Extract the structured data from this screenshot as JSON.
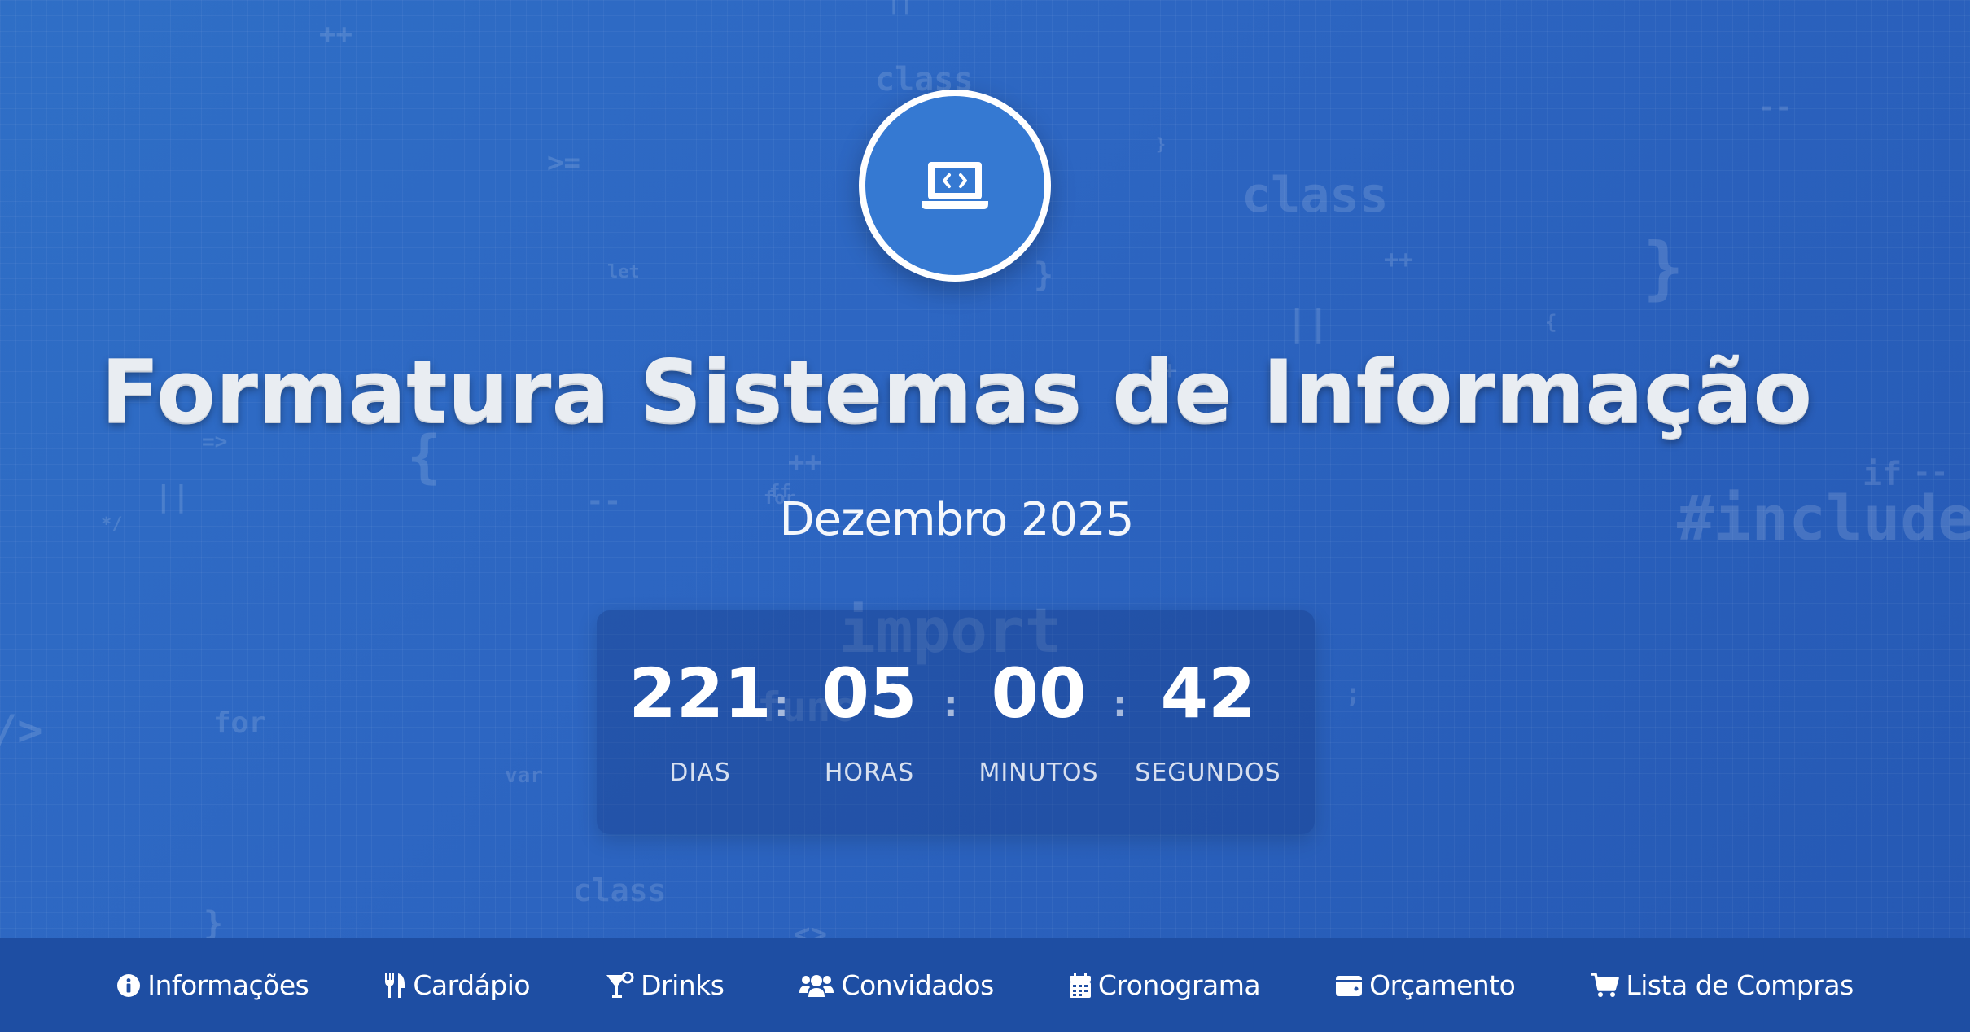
{
  "hero": {
    "title": "Formatura Sistemas de Informação",
    "date": "Dezembro 2025",
    "logo_icon": "laptop-code-icon"
  },
  "countdown": {
    "days": "221",
    "hours": "05",
    "minutes": "00",
    "seconds": "42",
    "days_label": "DIAS",
    "hours_label": "HORAS",
    "minutes_label": "MINUTOS",
    "seconds_label": "SEGUNDOS",
    "separator": ":"
  },
  "nav": {
    "items": [
      {
        "label": "Informações",
        "icon": "info-circle-icon"
      },
      {
        "label": "Cardápio",
        "icon": "utensils-icon"
      },
      {
        "label": "Drinks",
        "icon": "cocktail-icon"
      },
      {
        "label": "Convidados",
        "icon": "users-icon"
      },
      {
        "label": "Cronograma",
        "icon": "calendar-icon"
      },
      {
        "label": "Orçamento",
        "icon": "wallet-icon"
      },
      {
        "label": "Lista de Compras",
        "icon": "shopping-cart-icon"
      }
    ]
  },
  "background_code": [
    "++",
    "||",
    "class",
    "--",
    "}",
    ">=",
    "class",
    "let",
    "}",
    "++",
    "||",
    "{",
    "}",
    "++",
    "=>",
    "{",
    "++",
    "ff",
    "for",
    "if",
    "--",
    "||",
    "--",
    "*/",
    "#include",
    "import",
    ";",
    "/>",
    "for",
    "var",
    "class",
    "}",
    "<>",
    "func"
  ],
  "colors": {
    "background": "#2d66c2",
    "navbar": "#1e4ea3",
    "logo_circle": "#3579d2"
  }
}
